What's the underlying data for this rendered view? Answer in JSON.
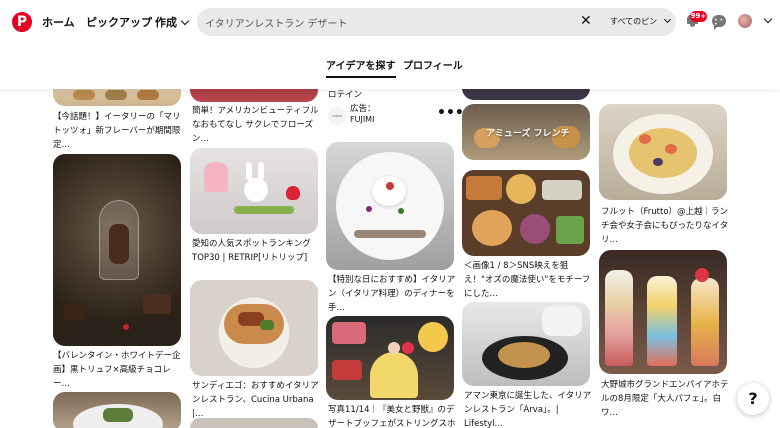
{
  "header": {
    "logo_glyph": "P",
    "nav": {
      "home": "ホーム",
      "pickup": "ピックアップ",
      "create": "作成"
    },
    "search": {
      "query": "イタリアンレストラン デザート",
      "clear_glyph": "✕",
      "scope": "すべてのピン"
    },
    "notification_badge": "99+",
    "accent_color": "#e60023"
  },
  "tabs": {
    "ideas": "アイデアを探す",
    "profile": "プロフィール"
  },
  "pins": {
    "col1": [
      {
        "caption": "【今話題！】イータリーの「マリトッツォ」新フレーバーが期間限定…"
      },
      {
        "caption": "【バレンタイン・ホワイトデー企画】黒トリュフ×高級チョコレー…"
      }
    ],
    "col2": [
      {
        "caption": "簡単！アメリカンビューティフルなおもてなし サクレでフローズン…"
      },
      {
        "caption": "愛知の人気スポットランキング TOP30 | RETRIP[リトリップ]"
      },
      {
        "caption": "サンディエゴ：おすすめイタリアンレストラン、Cucina Urbana |…"
      }
    ],
    "col3": [
      {
        "caption_top": "ロテイン"
      },
      {
        "ad_label": "広告：",
        "advertiser": "FUJIMI",
        "logo_text": "FUJIMI"
      },
      {
        "caption": "【特別な日におすすめ】イタリアン（イタリア料理）のディナーを手…"
      },
      {
        "caption": "写真11/14｜『美女と野獣』のデザートブッフェがストリングスホテ…"
      }
    ],
    "col4": [
      {
        "overlay": "アミューズ フレンチ"
      },
      {
        "caption": "＜画像1 / 8＞SNS映えを狙え！\"オズの魔法使い\"をモチーフにした…"
      },
      {
        "caption": "アマン東京に誕生した、イタリアンレストラン「Arva」。| Lifestyl…"
      }
    ],
    "col5": [
      {
        "caption": "フルット（Frutto）@上越｜ランチ会や女子会にもぴったりなイタリ…"
      },
      {
        "caption": "大野城市グランドエンパイアホテルの8月限定「大人パフェ」。白ワ…"
      }
    ]
  },
  "help_glyph": "?",
  "more_glyph": "•••"
}
